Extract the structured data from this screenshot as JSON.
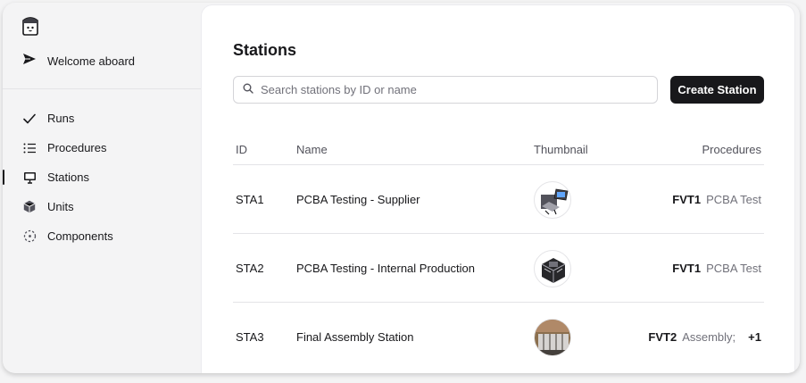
{
  "sidebar": {
    "welcome_label": "Welcome aboard",
    "items": [
      {
        "label": "Runs",
        "icon": "check-icon"
      },
      {
        "label": "Procedures",
        "icon": "list-icon"
      },
      {
        "label": "Stations",
        "icon": "monitor-icon",
        "active": true
      },
      {
        "label": "Units",
        "icon": "cube-icon"
      },
      {
        "label": "Components",
        "icon": "component-icon"
      }
    ]
  },
  "main": {
    "title": "Stations",
    "search_placeholder": "Search stations by ID or name",
    "create_label": "Create Station",
    "columns": [
      "ID",
      "Name",
      "Thumbnail",
      "Procedures"
    ],
    "rows": [
      {
        "id": "STA1",
        "name": "PCBA Testing - Supplier",
        "proc_code": "FVT1",
        "proc_name": "PCBA Test",
        "more": ""
      },
      {
        "id": "STA2",
        "name": "PCBA Testing - Internal Production",
        "proc_code": "FVT1",
        "proc_name": "PCBA Test",
        "more": ""
      },
      {
        "id": "STA3",
        "name": "Final Assembly Station",
        "proc_code": "FVT2",
        "proc_name": "Assembly;",
        "more": "+1"
      }
    ]
  },
  "colors": {
    "primary": "#18181b",
    "muted": "#71717a",
    "border": "#e4e4e7",
    "background": "#f4f4f5"
  }
}
